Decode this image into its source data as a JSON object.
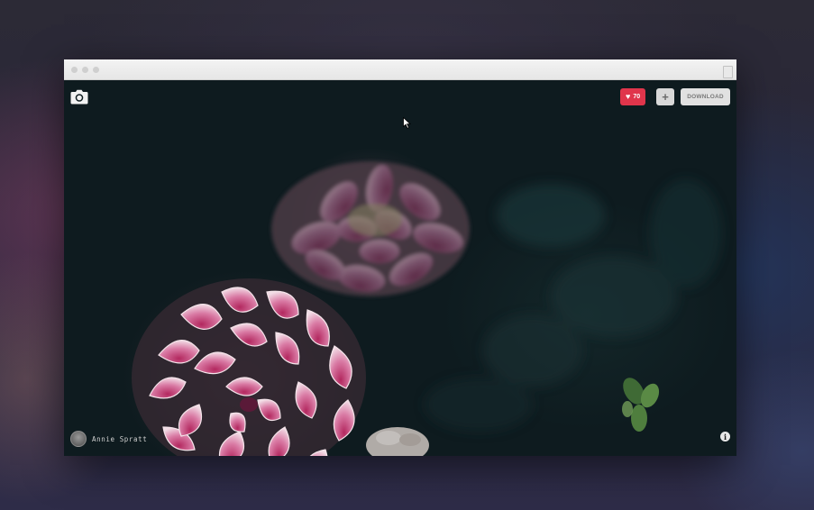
{
  "toolbar": {
    "like_count": "70",
    "collect_label": "+",
    "download_label": "DOWNLOAD"
  },
  "photo": {
    "author_name": "Annie Spratt"
  },
  "icons": {
    "camera": "camera-icon",
    "heart": "heart-icon",
    "info": "info-icon",
    "avatar": "avatar",
    "cursor": "mouse-cursor-icon"
  },
  "colors": {
    "like_accent": "#e0354b",
    "button_gray": "#e1e1e1",
    "photo_background": "#0e1b1f"
  }
}
